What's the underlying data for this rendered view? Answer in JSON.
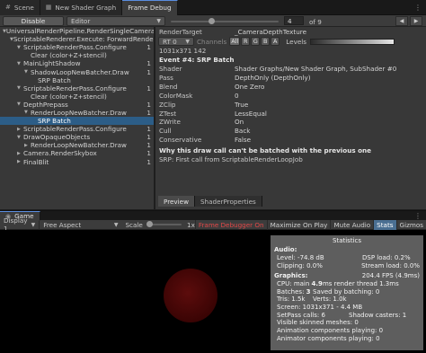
{
  "tabs": [
    {
      "label": "Scene",
      "icon": "hash-icon"
    },
    {
      "label": "New Shader Graph",
      "icon": "graph-icon"
    },
    {
      "label": "Frame Debug",
      "icon": "",
      "active": true
    }
  ],
  "toolbar": {
    "disable_label": "Disable",
    "mode_dropdown": "Editor",
    "slider_value": 4,
    "frame_index": "4",
    "of_label": "of 9"
  },
  "tree": [
    {
      "label": "UniversalRenderPipeline.RenderSingleCamera: 9",
      "indent": 0,
      "expanded": true,
      "count": ""
    },
    {
      "label": "ScriptableRenderer.Execute: ForwardRender 9",
      "indent": 1,
      "expanded": true,
      "count": ""
    },
    {
      "label": "ScriptableRenderPass.Configure",
      "indent": 2,
      "expanded": true,
      "count": "1"
    },
    {
      "label": "Clear (color+Z+stencil)",
      "indent": 3,
      "expanded": null,
      "count": ""
    },
    {
      "label": "MainLightShadow",
      "indent": 2,
      "expanded": true,
      "count": "1"
    },
    {
      "label": "ShadowLoopNewBatcher.Draw",
      "indent": 3,
      "expanded": true,
      "count": "1"
    },
    {
      "label": "SRP Batch",
      "indent": 4,
      "expanded": null,
      "count": ""
    },
    {
      "label": "ScriptableRenderPass.Configure",
      "indent": 2,
      "expanded": true,
      "count": "1"
    },
    {
      "label": "Clear (color+Z+stencil)",
      "indent": 3,
      "expanded": null,
      "count": ""
    },
    {
      "label": "DepthPrepass",
      "indent": 2,
      "expanded": true,
      "count": "1"
    },
    {
      "label": "RenderLoopNewBatcher.Draw",
      "indent": 3,
      "expanded": true,
      "count": "1"
    },
    {
      "label": "SRP Batch",
      "indent": 4,
      "expanded": null,
      "count": "",
      "selected": true
    },
    {
      "label": "ScriptableRenderPass.Configure",
      "indent": 2,
      "expanded": false,
      "count": "1"
    },
    {
      "label": "DrawOpaqueObjects",
      "indent": 2,
      "expanded": true,
      "count": "1"
    },
    {
      "label": "RenderLoopNewBatcher.Draw",
      "indent": 3,
      "expanded": false,
      "count": "1"
    },
    {
      "label": "Camera.RenderSkybox",
      "indent": 2,
      "expanded": false,
      "count": "1"
    },
    {
      "label": "FinalBlit",
      "indent": 2,
      "expanded": false,
      "count": "1"
    }
  ],
  "details": {
    "render_target_label": "RenderTarget",
    "render_target_value": "_CameraDepthTexture",
    "rt_dropdown": "RT 0",
    "channels_label": "Channels",
    "channels": [
      "All",
      "R",
      "G",
      "B",
      "A"
    ],
    "levels_label": "Levels",
    "resolution": "1031x371 142",
    "event_title": "Event #4: SRP Batch",
    "props": [
      {
        "k": "Shader",
        "v": "Shader Graphs/New Shader Graph, SubShader #0"
      },
      {
        "k": "Pass",
        "v": "DepthOnly (DepthOnly)"
      },
      {
        "k": "Blend",
        "v": "One Zero"
      },
      {
        "k": "ColorMask",
        "v": "0"
      },
      {
        "k": "ZClip",
        "v": "True"
      },
      {
        "k": "ZTest",
        "v": "LessEqual"
      },
      {
        "k": "ZWrite",
        "v": "On"
      },
      {
        "k": "Cull",
        "v": "Back"
      },
      {
        "k": "Conservative",
        "v": "False"
      }
    ],
    "batch_reason_title": "Why this draw call can't be batched with the previous one",
    "batch_reason": "SRP: First call from ScriptableRenderLoopJob",
    "bottom_tabs": [
      "Preview",
      "ShaderProperties"
    ]
  },
  "game": {
    "tab_label": "Game",
    "display": "Display 1",
    "aspect": "Free Aspect",
    "scale_label": "Scale",
    "scale_value": "1x",
    "buttons": [
      {
        "label": "Frame Debugger On",
        "state": "warn"
      },
      {
        "label": "Maximize On Play",
        "state": ""
      },
      {
        "label": "Mute Audio",
        "state": ""
      },
      {
        "label": "Stats",
        "state": "on"
      },
      {
        "label": "Gizmos",
        "state": ""
      }
    ]
  },
  "stats": {
    "title": "Statistics",
    "audio_title": "Audio:",
    "level": "Level: -74.8 dB",
    "dsp": "DSP load: 0.2%",
    "clipping": "Clipping: 0.0%",
    "stream": "Stream load: 0.0%",
    "graphics_title": "Graphics:",
    "fps": "204.4 FPS (4.9ms)",
    "cpu_pre": "CPU: main ",
    "cpu_main": "4.9",
    "cpu_post": "ms  render thread 1.3ms",
    "batches_pre": "Batches: ",
    "batches": "3",
    "saved": "Saved by batching: 0",
    "tris": "Tris: 1.5k",
    "verts": "Verts: 1.0k",
    "screen": "Screen: 1031x371 - 4.4 MB",
    "setpass": "SetPass calls: 6",
    "shadow": "Shadow casters: 1",
    "skinned": "Visible skinned meshes: 0",
    "anim_comp": "Animation components playing: 0",
    "animator": "Animator components playing: 0"
  },
  "colors": {
    "selection": "#2c5d87",
    "frame_debugger_on": "#e04848",
    "stats_active": "#4a6f92",
    "sphere": "#5a0a0a"
  }
}
